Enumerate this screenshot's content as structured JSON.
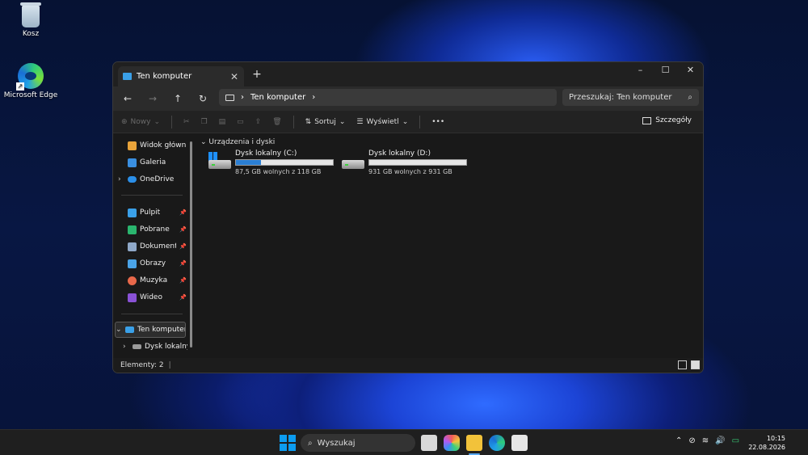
{
  "desktop": {
    "icons": [
      {
        "label": "Kosz",
        "icon": "recycle-bin-icon"
      },
      {
        "label": "Microsoft Edge",
        "icon": "edge-icon"
      }
    ]
  },
  "window": {
    "tab_title": "Ten komputer",
    "new_tab": "+",
    "controls": {
      "minimize": "–",
      "maximize": "☐",
      "close": "✕"
    }
  },
  "address": {
    "back": "←",
    "forward": "→",
    "up": "↑",
    "refresh": "↻",
    "path": "Ten komputer",
    "search_placeholder": "Przeszukaj: Ten komputer"
  },
  "toolbar": {
    "new_label": "Nowy",
    "sort_label": "Sortuj",
    "view_label": "Wyświetl",
    "more": "•••",
    "details_label": "Szczegóły"
  },
  "sidebar": {
    "home": "Widok główny",
    "gallery": "Galeria",
    "onedrive": "OneDrive",
    "pinned": [
      {
        "label": "Pulpit",
        "color": "#3aa0e8"
      },
      {
        "label": "Pobrane",
        "color": "#2ab56e"
      },
      {
        "label": "Dokumenty",
        "color": "#8fa8c8"
      },
      {
        "label": "Obrazy",
        "color": "#4aa3e6"
      },
      {
        "label": "Muzyka",
        "color": "#e8684a"
      },
      {
        "label": "Wideo",
        "color": "#8a52d6"
      }
    ],
    "this_pc": "Ten komputer",
    "local_disk": "Dysk lokalny (C"
  },
  "content": {
    "group_header": "Urządzenia i dyski",
    "drives": [
      {
        "name": "Dysk lokalny (C:)",
        "free_text": "87,5 GB wolnych z 118 GB",
        "used_fraction": 0.26,
        "system": true
      },
      {
        "name": "Dysk lokalny (D:)",
        "free_text": "931 GB wolnych z 931 GB",
        "used_fraction": 0.0,
        "system": false
      }
    ]
  },
  "status": {
    "items": "Elementy: 2"
  },
  "taskbar": {
    "search_label": "Wyszukaj",
    "time": "10:15",
    "date": "22.08.2026"
  }
}
